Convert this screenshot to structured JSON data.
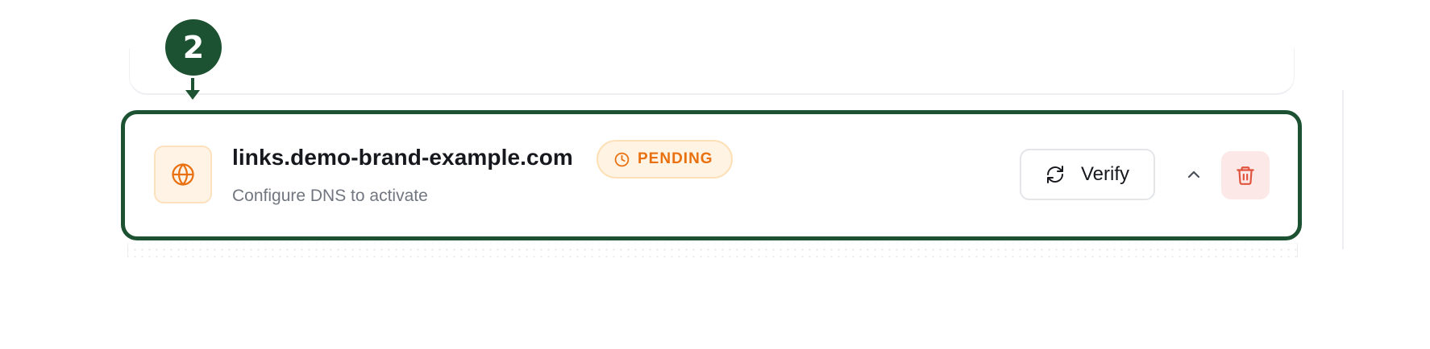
{
  "step_marker": {
    "number": "2",
    "color": "#1c5131"
  },
  "domain": {
    "name": "links.demo-brand-example.com",
    "subtitle": "Configure DNS to activate",
    "icon": "globe-icon",
    "status": {
      "label": "PENDING",
      "icon": "clock-icon",
      "color": "#e8700f"
    }
  },
  "actions": {
    "verify_label": "Verify",
    "verify_icon": "refresh-icon",
    "collapse_icon": "chevron-up-icon",
    "delete_icon": "trash-icon",
    "delete_color": "#e0533d"
  }
}
